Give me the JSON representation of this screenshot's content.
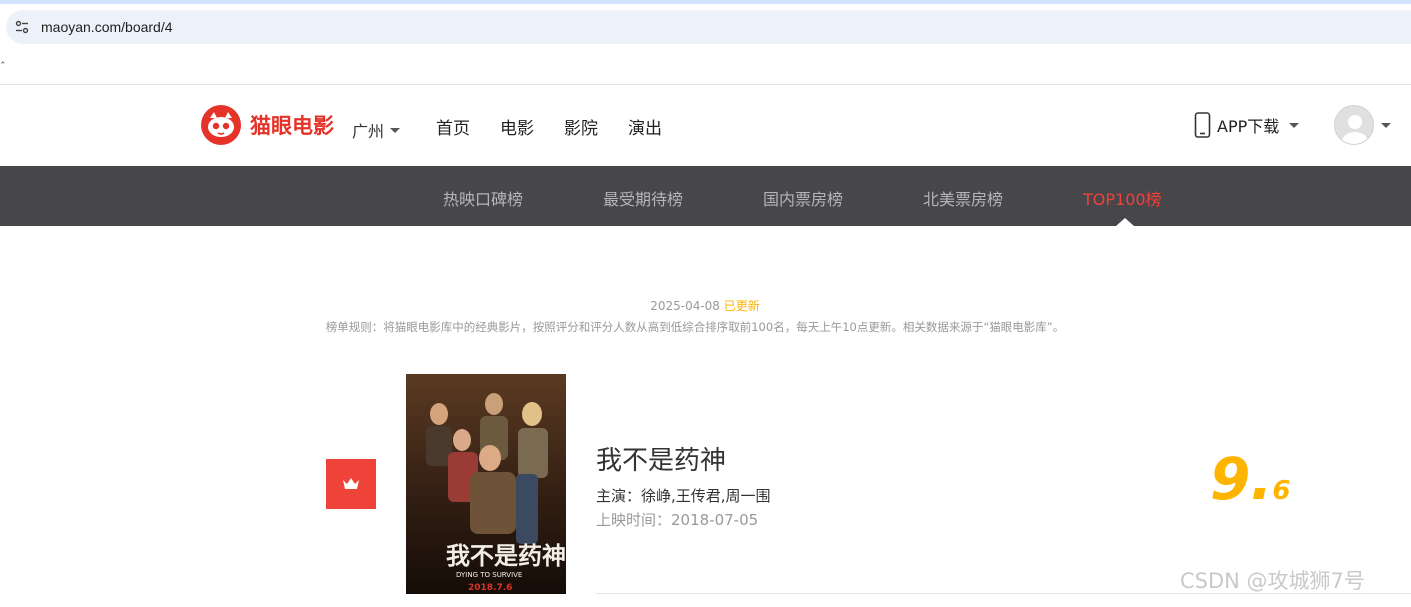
{
  "browser": {
    "url": "maoyan.com/board/4",
    "stray_mark": "ˆ"
  },
  "header": {
    "logo_text": "猫眼电影",
    "city": "广州",
    "nav": [
      "首页",
      "电影",
      "影院",
      "演出"
    ],
    "app_download": "APP下载"
  },
  "subnav": {
    "tabs": [
      "热映口碑榜",
      "最受期待榜",
      "国内票房榜",
      "北美票房榜",
      "TOP100榜"
    ],
    "active_index": 4
  },
  "board": {
    "date": "2025-04-08",
    "updated_label": "已更新",
    "rules": "榜单规则：将猫眼电影库中的经典影片，按照评分和评分人数从高到低综合排序取前100名，每天上午10点更新。相关数据来源于“猫眼电影库”。"
  },
  "movie": {
    "title": "我不是药神",
    "star": "主演：徐峥,王传君,周一围",
    "release": "上映时间：2018-07-05",
    "score_int": "9.",
    "score_frac": "6",
    "poster_text": "我不是药神",
    "poster_sub": "DYING TO SURVIVE",
    "poster_date": "2018.7.6"
  },
  "watermark": "CSDN @攻城狮7号",
  "colors": {
    "brand_red": "#ef4238",
    "score_yellow": "#ffb400",
    "subnav_bg": "#47464a"
  }
}
